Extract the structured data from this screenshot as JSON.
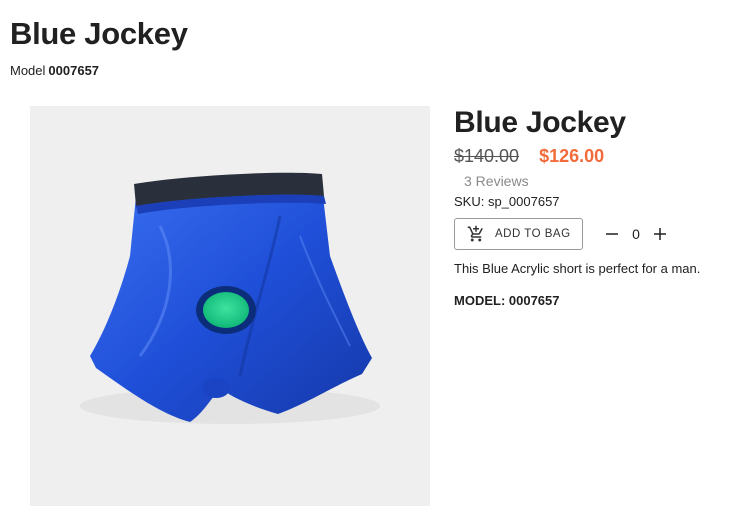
{
  "header": {
    "title": "Blue Jockey",
    "model_prefix": "Model",
    "model_number": "0007657"
  },
  "product": {
    "image_subject": "blue-boxer-shorts",
    "title": "Blue Jockey",
    "old_price": "$140.00",
    "new_price": "$126.00",
    "reviews": "3 Reviews",
    "sku": "SKU: sp_0007657",
    "add_to_bag_label": "ADD TO BAG",
    "quantity": "0",
    "description": "This Blue Acrylic short is perfect for a man.",
    "model_spec": "MODEL: 0007657"
  },
  "colors": {
    "sale_price": "#f26b3a",
    "product_blue": "#1f4fd8",
    "text": "#212121",
    "muted": "#8a8a8a"
  },
  "icons": {
    "cart": "add-shopping-cart-icon",
    "decrement": "minus-icon",
    "increment": "plus-icon"
  }
}
